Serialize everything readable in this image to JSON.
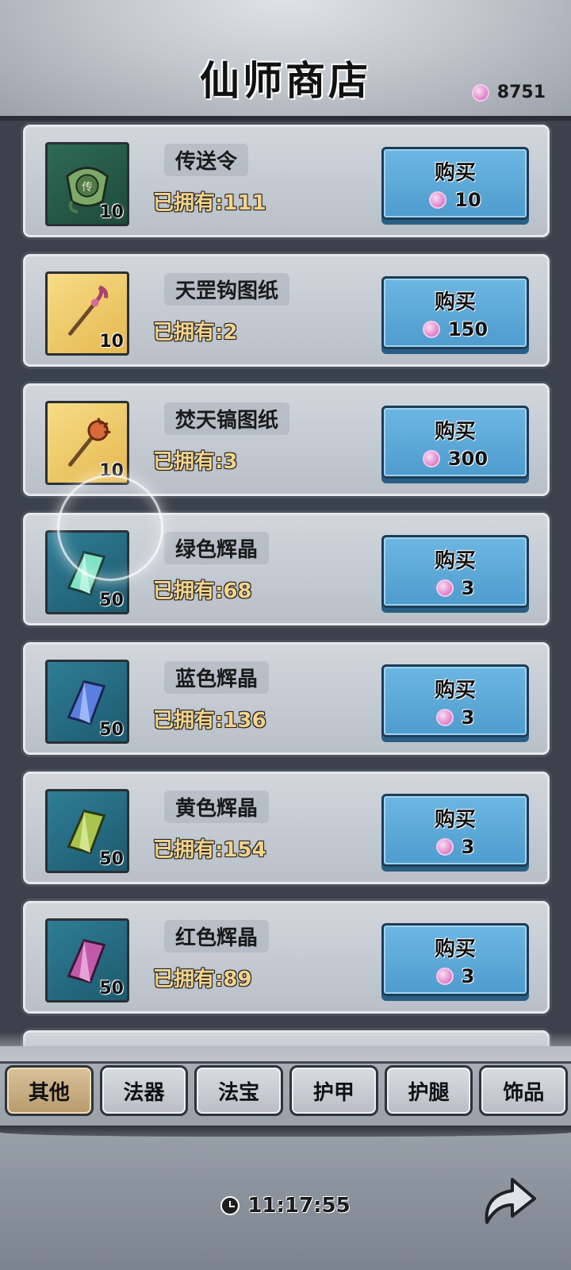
{
  "header": {
    "title": "仙师商店",
    "currency": {
      "icon": "pink-gem-icon",
      "value": "8751"
    }
  },
  "items": [
    {
      "name": "传送令",
      "owned": "已拥有:111",
      "qty": "10",
      "icon": "token-icon",
      "buy_label": "购买",
      "price": "10"
    },
    {
      "name": "天罡钩图纸",
      "owned": "已拥有:2",
      "qty": "10",
      "icon": "scroll-hook-icon",
      "buy_label": "购买",
      "price": "150"
    },
    {
      "name": "焚天镐图纸",
      "owned": "已拥有:3",
      "qty": "10",
      "icon": "scroll-pick-icon",
      "buy_label": "购买",
      "price": "300"
    },
    {
      "name": "绿色辉晶",
      "owned": "已拥有:68",
      "qty": "50",
      "icon": "green-crystal-icon",
      "buy_label": "购买",
      "price": "3"
    },
    {
      "name": "蓝色辉晶",
      "owned": "已拥有:136",
      "qty": "50",
      "icon": "blue-crystal-icon",
      "buy_label": "购买",
      "price": "3"
    },
    {
      "name": "黄色辉晶",
      "owned": "已拥有:154",
      "qty": "50",
      "icon": "yellow-crystal-icon",
      "buy_label": "购买",
      "price": "3"
    },
    {
      "name": "红色辉晶",
      "owned": "已拥有:89",
      "qty": "50",
      "icon": "red-crystal-icon",
      "buy_label": "购买",
      "price": "3"
    }
  ],
  "tabs": [
    "其他",
    "法器",
    "法宝",
    "护甲",
    "护腿",
    "饰品"
  ],
  "active_tab": "其他",
  "timer": {
    "icon": "clock-icon",
    "value": "11:17:55"
  },
  "colors": {
    "buy_button": "#5aa8d8",
    "owned_text": "#f4d38a",
    "gem": "#e79bd6",
    "active_tab": "#c9ae82"
  }
}
